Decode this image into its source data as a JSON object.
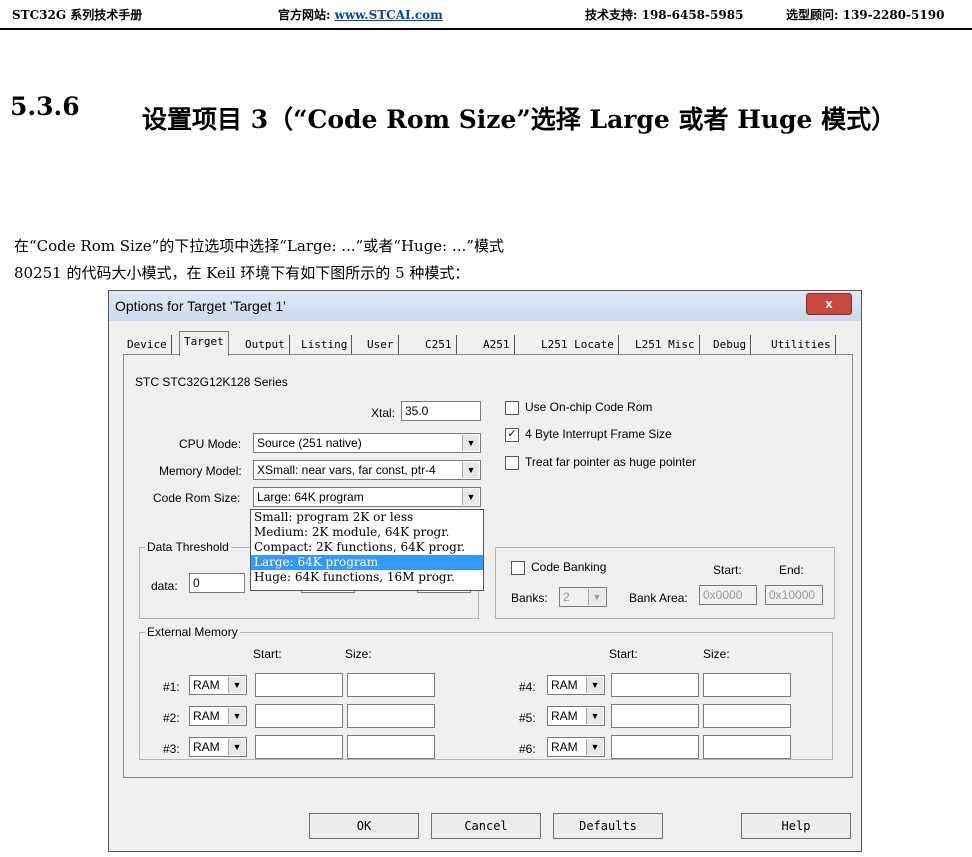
{
  "header": {
    "manual": "STC32G 系列技术手册",
    "website_label": "官方网站:",
    "website": "www.STCAI.com",
    "support": "技术支持: 198-6458-5985",
    "advisor": "选型顾问: 139-2280-5190"
  },
  "section": {
    "number": "5.3.6",
    "title": "设置项目 3（“Code Rom Size”选择 Large 或者 Huge 模式）"
  },
  "paragraphs": [
    "在“Code Rom Size”的下拉选项中选择“Large: ...”或者“Huge: ...”模式",
    "80251 的代码大小模式，在 Keil 环境下有如下图所示的 5 种模式："
  ],
  "dialog": {
    "title": "Options for Target 'Target 1'",
    "close": "x",
    "tabs": [
      "Device",
      "Target",
      "Output",
      "Listing",
      "User",
      "C251",
      "A251",
      "L251 Locate",
      "L251 Misc",
      "Debug",
      "Utilities"
    ],
    "selected_tab": "Target",
    "device": "STC STC32G12K128 Series",
    "xtal_label": "Xtal:",
    "xtal": "35.0",
    "cpu_mode_label": "CPU Mode:",
    "cpu_mode": "Source (251 native)",
    "memory_model_label": "Memory Model:",
    "memory_model": "XSmall: near vars, far const, ptr-4",
    "code_rom_label": "Code Rom Size:",
    "code_rom": "Large: 64K program",
    "code_rom_options": [
      "Small: program 2K or less",
      "Medium: 2K module, 64K progr.",
      "Compact: 2K functions, 64K progr.",
      "Large: 64K program",
      "Huge: 64K functions, 16M progr."
    ],
    "checks": [
      {
        "label": "Use On-chip Code Rom",
        "checked": false
      },
      {
        "label": "4 Byte Interrupt Frame Size",
        "checked": true
      },
      {
        "label": "Treat far pointer as huge pointer",
        "checked": false
      }
    ],
    "data_threshold_title": "Data Threshold",
    "data_label": "data:",
    "data_value": "0",
    "code_banking_label": "Code Banking",
    "start_label": "Start:",
    "end_label": "End:",
    "banks_label": "Banks:",
    "banks_value": "2",
    "bank_area_label": "Bank Area:",
    "bank_start": "0x0000",
    "bank_end": "0x10000",
    "ext_mem_title": "External Memory",
    "size_label": "Size:",
    "ext_rows": [
      {
        "label": "#1:",
        "type": "RAM"
      },
      {
        "label": "#2:",
        "type": "RAM"
      },
      {
        "label": "#3:",
        "type": "RAM"
      },
      {
        "label": "#4:",
        "type": "RAM"
      },
      {
        "label": "#5:",
        "type": "RAM"
      },
      {
        "label": "#6:",
        "type": "RAM"
      }
    ],
    "buttons": {
      "ok": "OK",
      "cancel": "Cancel",
      "defaults": "Defaults",
      "help": "Help"
    }
  }
}
